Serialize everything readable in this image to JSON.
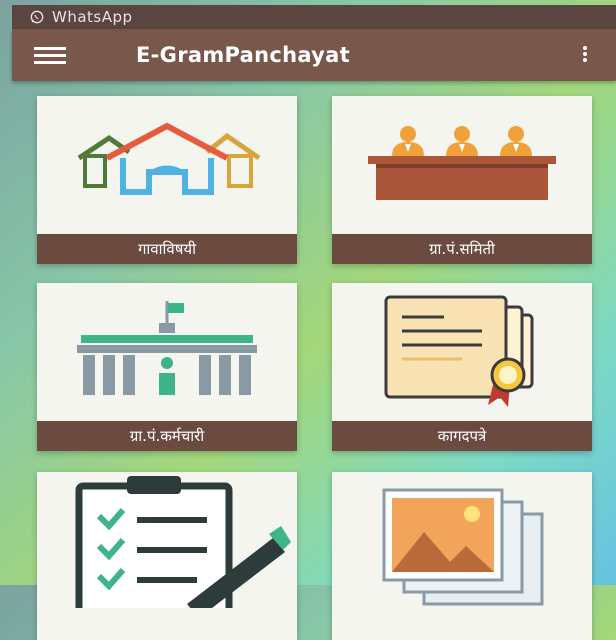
{
  "status_bar": {
    "app_name": "WhatsApp",
    "icon": "whatsapp-icon"
  },
  "app_bar": {
    "title": "E-GramPanchayat",
    "menu_icon": "hamburger-icon",
    "more_icon": "more-vert-icon"
  },
  "tiles": [
    {
      "label": "गावाविषयी",
      "icon": "houses-icon"
    },
    {
      "label": "ग्रा.पं.समिती",
      "icon": "committee-icon"
    },
    {
      "label": "ग्रा.पं.कर्मचारी",
      "icon": "office-building-icon"
    },
    {
      "label": "कागदपत्रे",
      "icon": "documents-certificate-icon"
    },
    {
      "label": "",
      "icon": "checklist-icon"
    },
    {
      "label": "",
      "icon": "photo-gallery-icon"
    }
  ],
  "colors": {
    "app_bar": "#7a574b",
    "status_bar": "#5a4540",
    "tile_label_bg": "#6b4a40",
    "tile_bg": "#f4f5ef"
  }
}
